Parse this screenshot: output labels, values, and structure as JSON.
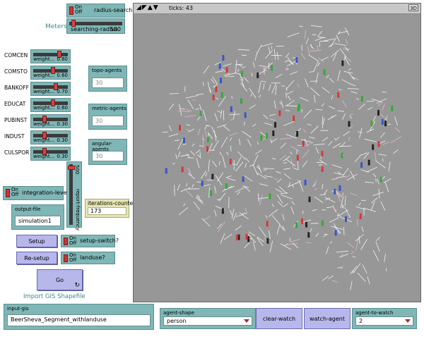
{
  "radius_search": {
    "label": "radius-search?",
    "on": "On",
    "off": "Off"
  },
  "meters_label": "Meters",
  "searching_radius": {
    "name": "searching-radius",
    "value": "500",
    "fraction": 0.06
  },
  "weights": [
    {
      "side": "COMCEN",
      "name": "weight...",
      "value": "0.80",
      "fraction": 0.8
    },
    {
      "side": "COMSTO",
      "name": "weight...",
      "value": "0.60",
      "fraction": 0.6
    },
    {
      "side": "BANKOFF",
      "name": "weight...",
      "value": "0.70",
      "fraction": 0.7
    },
    {
      "side": "EDUCAT",
      "name": "weight...",
      "value": "0.60",
      "fraction": 0.6
    },
    {
      "side": "PUBINST",
      "name": "weight...",
      "value": "0.30",
      "fraction": 0.3
    },
    {
      "side": "INDUST",
      "name": "weight...",
      "value": "0.30",
      "fraction": 0.3
    },
    {
      "side": "CULSPOR",
      "name": "weight...",
      "value": "0.30",
      "fraction": 0.3
    }
  ],
  "topo_agents": {
    "label": "topo-agents",
    "value": "30"
  },
  "metric_agents": {
    "label": "metric-agents",
    "value": "30"
  },
  "angular_agents": {
    "label": "angular-agents",
    "value": "30"
  },
  "integration_level": {
    "label": "integration-level?",
    "on": "On",
    "off": "Off"
  },
  "report_frequency": {
    "name": "report-frequency",
    "value": "500"
  },
  "output_file": {
    "label": "output-file",
    "value": "simulation1"
  },
  "iterations_counter": {
    "label": "iterations-counter",
    "value": "173"
  },
  "setup_button": "Setup",
  "setup_switch": {
    "label": "setup-switch?",
    "on": "On",
    "off": "Off"
  },
  "resetup_button": "Re-setup",
  "landuse": {
    "label": "landuse?",
    "on": "On",
    "off": "Off"
  },
  "go_button": "Go",
  "import_label": "Import GIS Shapefile",
  "input_gis": {
    "label": "input-gis",
    "value": "BeerSheva_Segment_withlanduse"
  },
  "agent_shape": {
    "label": "agent-shape",
    "value": "person"
  },
  "clear_watch": "clear-watch",
  "watch_agent": "watch-agent",
  "agent_to_watch": {
    "label": "agent-to-watch",
    "value": "2"
  },
  "view": {
    "ticks_label": "ticks: 43",
    "btn_3d": "3D"
  },
  "colors": {
    "widget": "#7fb6b6",
    "button": "#b7b7ec",
    "monitor": "#e6e6b4",
    "view_bg": "#979797",
    "agent_red": "#d33",
    "agent_green": "#3a3",
    "agent_blue": "#3355cc"
  }
}
